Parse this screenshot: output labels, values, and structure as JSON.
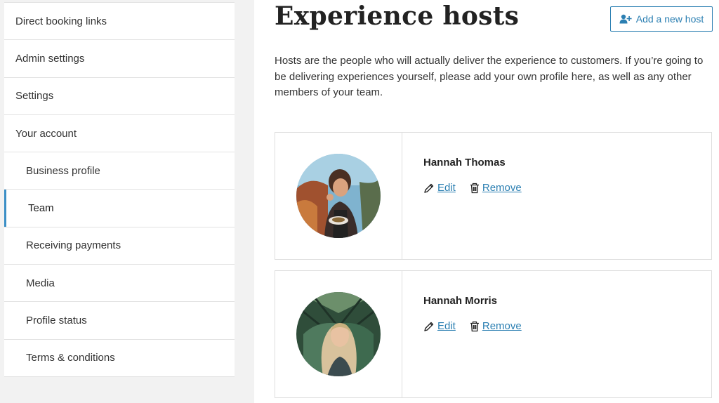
{
  "sidebar": {
    "items": [
      {
        "label": "Direct booking links"
      },
      {
        "label": "Admin settings"
      },
      {
        "label": "Settings"
      },
      {
        "label": "Your account"
      },
      {
        "label": "Business profile"
      },
      {
        "label": "Team"
      },
      {
        "label": "Receiving payments"
      },
      {
        "label": "Media"
      },
      {
        "label": "Profile status"
      },
      {
        "label": "Terms & conditions"
      }
    ],
    "active": "Team"
  },
  "main": {
    "title": "Experience hosts",
    "add_button_label": "Add a new host",
    "add_button_icon": "add-user-icon",
    "intro": "Hosts are the people who will actually deliver the experience to customers. If you’re going to be delivering experiences yourself, please add your own profile here, as well as any other members of your team.",
    "hosts": [
      {
        "name": "Hannah Thomas",
        "edit_label": "Edit",
        "remove_label": "Remove"
      },
      {
        "name": "Hannah Morris",
        "edit_label": "Edit",
        "remove_label": "Remove"
      }
    ]
  },
  "colors": {
    "accent": "#2b7fb2",
    "active_bar": "#3b8fc6",
    "sidebar_bg": "#f2f2f2",
    "border": "#dedede"
  }
}
